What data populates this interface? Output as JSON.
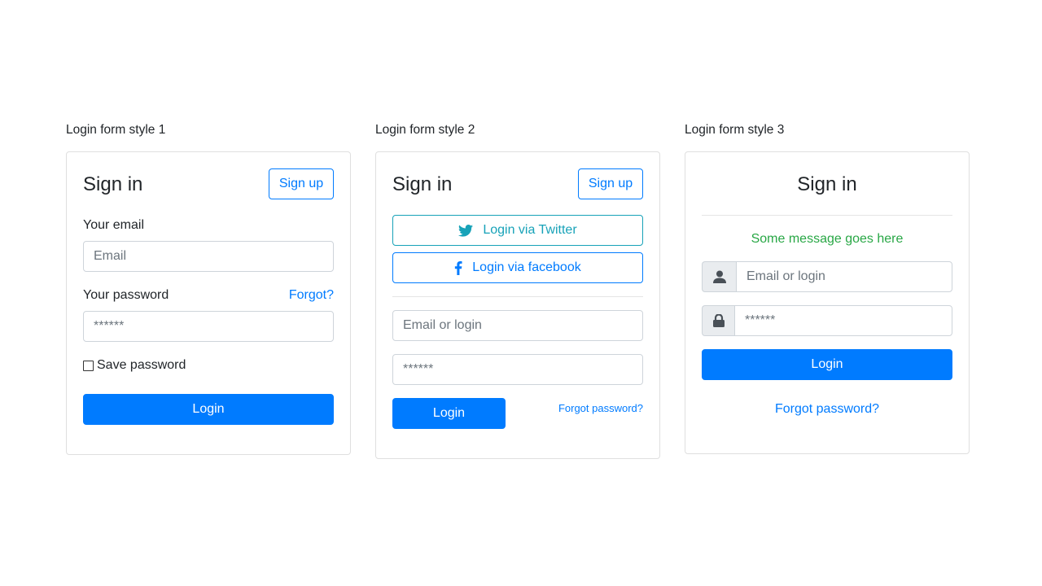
{
  "forms": [
    {
      "section_title": "Login form style 1",
      "title": "Sign in",
      "signup_label": "Sign up",
      "email_label": "Your email",
      "email_placeholder": "Email",
      "password_label": "Your password",
      "forgot_label": "Forgot?",
      "password_placeholder": "******",
      "save_password_label": "Save password",
      "save_password_checked": false,
      "login_label": "Login"
    },
    {
      "section_title": "Login form style 2",
      "title": "Sign in",
      "signup_label": "Sign up",
      "twitter_label": "Login via Twitter",
      "facebook_label": "Login via facebook",
      "email_placeholder": "Email or login",
      "password_placeholder": "******",
      "login_label": "Login",
      "forgot_label": "Forgot password?"
    },
    {
      "section_title": "Login form style 3",
      "title": "Sign in",
      "message": "Some message goes here",
      "email_placeholder": "Email or login",
      "password_placeholder": "******",
      "login_label": "Login",
      "forgot_label": "Forgot password?"
    }
  ],
  "icons": {
    "twitter": "twitter-icon",
    "facebook": "facebook-icon",
    "user": "user-icon",
    "lock": "lock-icon"
  },
  "colors": {
    "primary": "#007bff",
    "info": "#17a2b8",
    "success": "#28a745",
    "input_addon_bg": "#e9ecef"
  }
}
